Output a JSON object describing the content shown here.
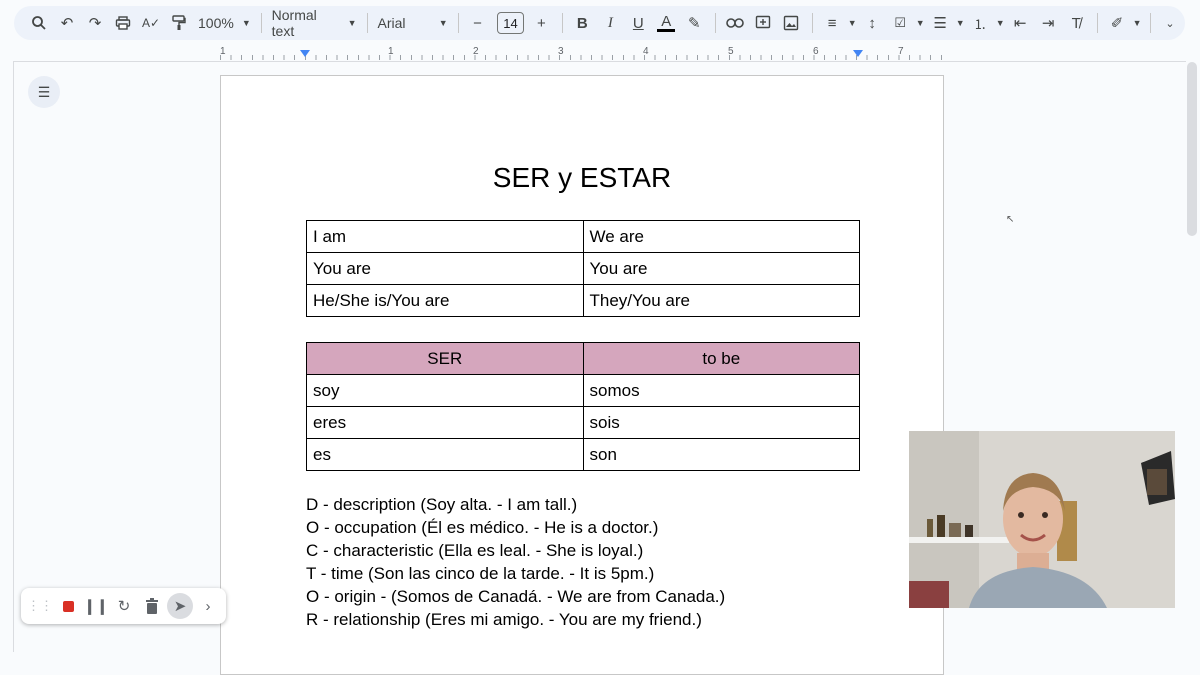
{
  "toolbar": {
    "zoom": "100%",
    "style": "Normal text",
    "font": "Arial",
    "font_size": "14",
    "icons": [
      "search-icon",
      "undo-icon",
      "redo-icon",
      "print-icon",
      "spellcheck-icon",
      "paint-format-icon"
    ]
  },
  "ruler": {
    "labels": [
      "1",
      "1",
      "2",
      "3",
      "4",
      "5",
      "6",
      "7"
    ]
  },
  "document": {
    "title": "SER y ESTAR",
    "pronouns_table": [
      [
        "I am",
        "We are"
      ],
      [
        "You are",
        "You are"
      ],
      [
        "He/She is/You are",
        "They/You are"
      ]
    ],
    "ser_table": {
      "header": [
        "SER",
        "to be"
      ],
      "rows": [
        [
          "soy",
          "somos"
        ],
        [
          "eres",
          "sois"
        ],
        [
          "es",
          "son"
        ]
      ]
    },
    "notes": [
      "D - description (Soy alta. - I am tall.)",
      "O - occupation (Él es médico. - He is a doctor.)",
      "C - characteristic (Ella es leal. - She is loyal.)",
      "T - time (Son las cinco de la tarde. - It is 5pm.)",
      "O - origin - (Somos de Canadá. - We are from Canada.)",
      "R - relationship (Eres mi amigo. - You are my friend.)"
    ]
  },
  "colors": {
    "table_header": "#d5a6bd",
    "toolbar_bg": "#edf2fa",
    "accent": "#4285f4",
    "record_red": "#d93025"
  }
}
